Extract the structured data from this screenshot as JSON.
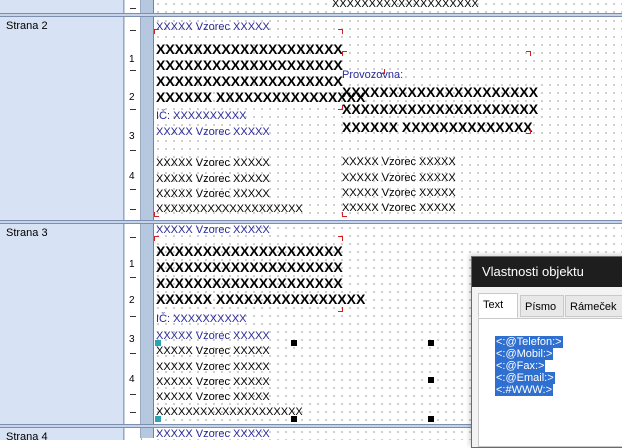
{
  "bands": {
    "strana2_label": "Strana 2",
    "strana3_label": "Strana 3",
    "strana4_label": "Strana 4"
  },
  "ruler": {
    "numbers_a": [
      "1",
      "2",
      "3",
      "4"
    ],
    "numbers_b": [
      "1",
      "2",
      "3",
      "4"
    ]
  },
  "top_strip": {
    "text": "XXXXXXXXXXXXXXXXXXXX"
  },
  "band2": {
    "vzorec_blue": "XXXXX Vzorec XXXXX",
    "bold_lines": [
      "XXXXXXXXXXXXXXXXXXXX",
      "XXXXXXXXXXXXXXXXXXXX",
      "XXXXXXXXXXXXXXXXXXXX",
      "XXXXXX XXXXXXXXXXXXXXXX"
    ],
    "ic": "IČ: XXXXXXXXXX",
    "vzorec_blue2": "XXXXX Vzorec XXXXX",
    "vzorec_small": [
      "XXXXX Vzorec XXXXX",
      "XXXXX Vzorec XXXXX",
      "XXXXX Vzorec XXXXX",
      "XXXXX Vzorec XXXXX"
    ],
    "long_small": "XXXXXXXXXXXXXXXXXXXX",
    "provozovna_label": "Provozovna:",
    "prov_bold": [
      "XXXXXXXXXXXXXXXXXXXXX",
      "XXXXXXXXXXXXXXXXXXXXX",
      "XXXXXX XXXXXXXXXXXXXX"
    ],
    "prov_small": [
      "XXXXX Vzorec XXXXX",
      "XXXXX Vzorec XXXXX",
      "XXXXX Vzorec XXXXX",
      "XXXXX Vzorec XXXXX"
    ]
  },
  "band3": {
    "vzorec_blue": "XXXXX Vzorec XXXXX",
    "bold_lines": [
      "XXXXXXXXXXXXXXXXXXXX",
      "XXXXXXXXXXXXXXXXXXXX",
      "XXXXXXXXXXXXXXXXXXXX",
      "XXXXXX XXXXXXXXXXXXXXXX"
    ],
    "ic": "IČ: XXXXXXXXXX",
    "vzorec_blue2": "XXXXX Vzorec XXXXX",
    "vzorec_small": [
      "XXXXX Vzorec XXXXX",
      "XXXXX Vzorec XXXXX",
      "XXXXX Vzorec XXXXX",
      "XXXXX Vzorec XXXXX"
    ],
    "long_small": "XXXXXXXXXXXXXXXXXXXX"
  },
  "band4": {
    "vzorec_blue": "XXXXX Vzorec XXXXX"
  },
  "dialog": {
    "title": "Vlastnosti objektu",
    "tabs": [
      "Text",
      "Písmo",
      "Rámeček"
    ],
    "active_tab": "Text",
    "lines": [
      "<:@Telefon:>",
      "<:@Mobil:>",
      "<:@Fax:>",
      "<:@Email:>",
      "<:#WWW:>"
    ]
  },
  "colors": {
    "band_label_bg": "#d7e3f4",
    "selection": "#2f6fd0",
    "marker_red": "#d02020",
    "formula_blue": "#2a2a9a",
    "dialog_title_bg": "#1e1e1e"
  }
}
